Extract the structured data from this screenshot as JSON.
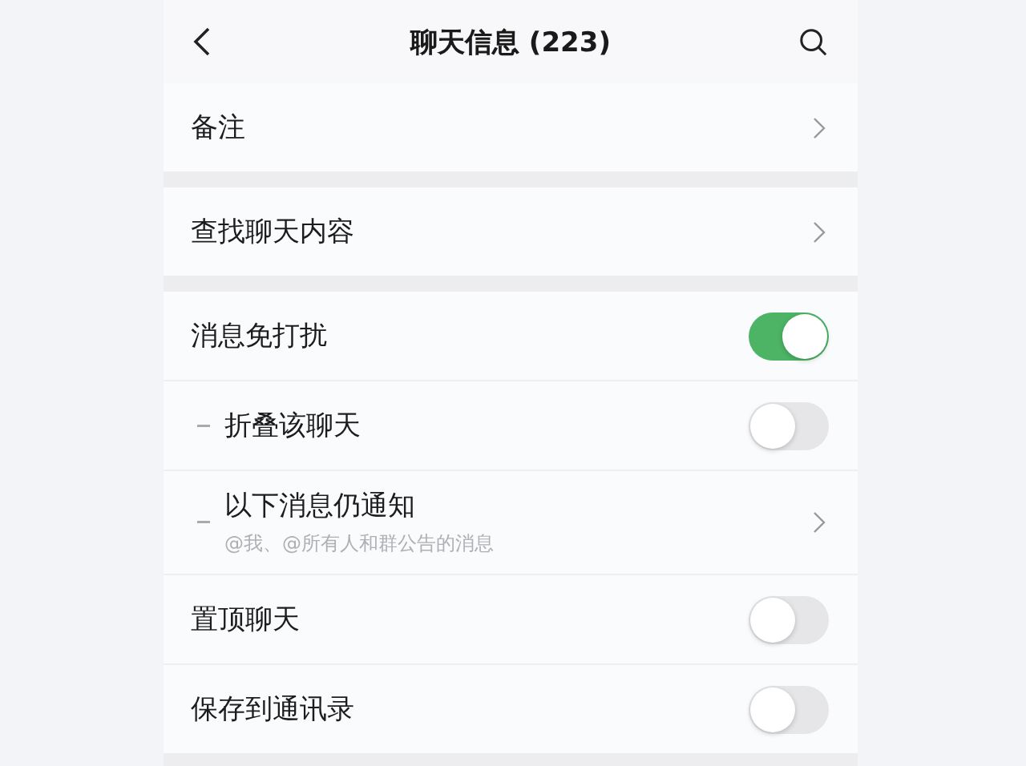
{
  "header": {
    "title": "聊天信息 (223)"
  },
  "groups": [
    {
      "rows": [
        {
          "label": "备注",
          "kind": "link"
        }
      ]
    },
    {
      "rows": [
        {
          "label": "查找聊天内容",
          "kind": "link"
        }
      ]
    },
    {
      "rows": [
        {
          "label": "消息免打扰",
          "kind": "toggle",
          "on": true,
          "children": [
            {
              "label": "折叠该聊天",
              "kind": "toggle",
              "on": false
            },
            {
              "label": "以下消息仍通知",
              "kind": "link",
              "subtitle": "@我、@所有人和群公告的消息"
            }
          ]
        },
        {
          "label": "置顶聊天",
          "kind": "toggle",
          "on": false
        },
        {
          "label": "保存到通讯录",
          "kind": "toggle",
          "on": false
        }
      ]
    }
  ]
}
